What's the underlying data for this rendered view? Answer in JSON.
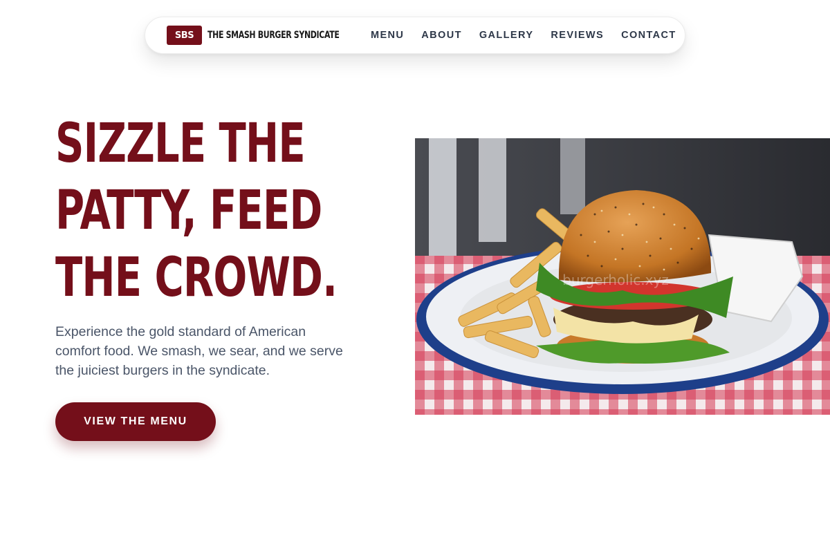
{
  "brand": {
    "badge": "SBS",
    "name": "THE SMASH BURGER SYNDICATE",
    "accent_color": "#740f1a"
  },
  "nav": {
    "links": [
      "MENU",
      "ABOUT",
      "GALLERY",
      "REVIEWS",
      "CONTACT"
    ]
  },
  "hero": {
    "title_lines": [
      "SIZZLE THE",
      "PATTY, FEED",
      "THE CROWD."
    ],
    "description": "Experience the gold standard of American comfort food. We smash, we sear, and we serve the juiciest burgers in the syndicate.",
    "cta_label": "VIEW THE MENU",
    "image_watermark": "burgerholic.xyz"
  }
}
